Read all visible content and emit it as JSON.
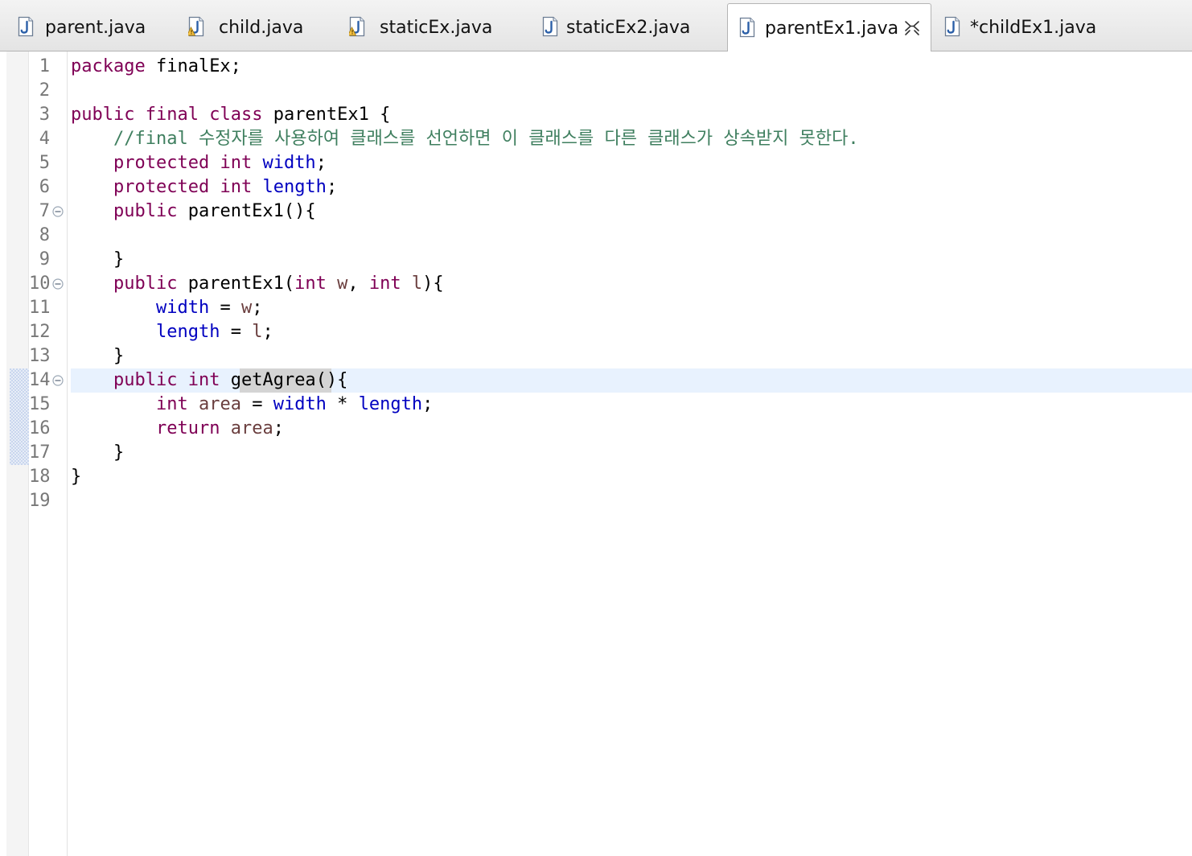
{
  "tabs": [
    {
      "label": "parent.java",
      "icon": "java-file-icon",
      "warning": false,
      "active": false
    },
    {
      "label": "child.java",
      "icon": "java-file-warning-icon",
      "warning": true,
      "active": false
    },
    {
      "label": "staticEx.java",
      "icon": "java-file-warning-icon",
      "warning": true,
      "active": false
    },
    {
      "label": "staticEx2.java",
      "icon": "java-file-icon",
      "warning": false,
      "active": false
    },
    {
      "label": "parentEx1.java",
      "icon": "java-file-icon",
      "warning": false,
      "active": true
    },
    {
      "label": "*childEx1.java",
      "icon": "java-file-icon",
      "warning": false,
      "active": false
    }
  ],
  "editor": {
    "colors": {
      "keyword": "#7f0055",
      "field": "#0000c0",
      "comment": "#3f7f5f",
      "local": "#6a3e3e",
      "current_line": "#e8f2fe",
      "occurrence": "#d4d4d4"
    },
    "current_line": 14,
    "lines": [
      {
        "n": "1",
        "fold": false,
        "tokens": [
          {
            "t": "package",
            "c": "kw"
          },
          {
            "t": " finalEx;",
            "c": "plain"
          }
        ]
      },
      {
        "n": "2",
        "fold": false,
        "tokens": []
      },
      {
        "n": "3",
        "fold": false,
        "tokens": [
          {
            "t": "public",
            "c": "kw"
          },
          {
            "t": " ",
            "c": "plain"
          },
          {
            "t": "final",
            "c": "kw"
          },
          {
            "t": " ",
            "c": "plain"
          },
          {
            "t": "class",
            "c": "kw"
          },
          {
            "t": " parentEx1 {",
            "c": "plain"
          }
        ]
      },
      {
        "n": "4",
        "fold": false,
        "tokens": [
          {
            "t": "    ",
            "c": "plain"
          },
          {
            "t": "//final 수정자를 사용하여 클래스를 선언하면 이 클래스를 다른 클래스가 상속받지 못한다.",
            "c": "cmt"
          }
        ]
      },
      {
        "n": "5",
        "fold": false,
        "tokens": [
          {
            "t": "    ",
            "c": "plain"
          },
          {
            "t": "protected",
            "c": "kw"
          },
          {
            "t": " ",
            "c": "plain"
          },
          {
            "t": "int",
            "c": "kw"
          },
          {
            "t": " ",
            "c": "plain"
          },
          {
            "t": "width",
            "c": "fld"
          },
          {
            "t": ";",
            "c": "plain"
          }
        ]
      },
      {
        "n": "6",
        "fold": false,
        "tokens": [
          {
            "t": "    ",
            "c": "plain"
          },
          {
            "t": "protected",
            "c": "kw"
          },
          {
            "t": " ",
            "c": "plain"
          },
          {
            "t": "int",
            "c": "kw"
          },
          {
            "t": " ",
            "c": "plain"
          },
          {
            "t": "length",
            "c": "fld"
          },
          {
            "t": ";",
            "c": "plain"
          }
        ]
      },
      {
        "n": "7",
        "fold": true,
        "tokens": [
          {
            "t": "    ",
            "c": "plain"
          },
          {
            "t": "public",
            "c": "kw"
          },
          {
            "t": " parentEx1(){",
            "c": "plain"
          }
        ]
      },
      {
        "n": "8",
        "fold": false,
        "tokens": []
      },
      {
        "n": "9",
        "fold": false,
        "tokens": [
          {
            "t": "    }",
            "c": "plain"
          }
        ]
      },
      {
        "n": "10",
        "fold": true,
        "tokens": [
          {
            "t": "    ",
            "c": "plain"
          },
          {
            "t": "public",
            "c": "kw"
          },
          {
            "t": " parentEx1(",
            "c": "plain"
          },
          {
            "t": "int",
            "c": "kw"
          },
          {
            "t": " ",
            "c": "plain"
          },
          {
            "t": "w",
            "c": "local"
          },
          {
            "t": ", ",
            "c": "plain"
          },
          {
            "t": "int",
            "c": "kw"
          },
          {
            "t": " ",
            "c": "plain"
          },
          {
            "t": "l",
            "c": "local"
          },
          {
            "t": "){",
            "c": "plain"
          }
        ]
      },
      {
        "n": "11",
        "fold": false,
        "tokens": [
          {
            "t": "        ",
            "c": "plain"
          },
          {
            "t": "width",
            "c": "fld"
          },
          {
            "t": " = ",
            "c": "plain"
          },
          {
            "t": "w",
            "c": "local"
          },
          {
            "t": ";",
            "c": "plain"
          }
        ]
      },
      {
        "n": "12",
        "fold": false,
        "tokens": [
          {
            "t": "        ",
            "c": "plain"
          },
          {
            "t": "length",
            "c": "fld"
          },
          {
            "t": " = ",
            "c": "plain"
          },
          {
            "t": "l",
            "c": "local"
          },
          {
            "t": ";",
            "c": "plain"
          }
        ]
      },
      {
        "n": "13",
        "fold": false,
        "tokens": [
          {
            "t": "    }",
            "c": "plain"
          }
        ]
      },
      {
        "n": "14",
        "fold": true,
        "tokens": [
          {
            "t": "    ",
            "c": "plain"
          },
          {
            "t": "public",
            "c": "kw"
          },
          {
            "t": " ",
            "c": "plain"
          },
          {
            "t": "int",
            "c": "kw"
          },
          {
            "t": " ",
            "c": "plain"
          },
          {
            "t": "getAgrea",
            "c": "plain",
            "occ": true
          },
          {
            "t": "(){",
            "c": "plain"
          }
        ]
      },
      {
        "n": "15",
        "fold": false,
        "tokens": [
          {
            "t": "        ",
            "c": "plain"
          },
          {
            "t": "int",
            "c": "kw"
          },
          {
            "t": " ",
            "c": "plain"
          },
          {
            "t": "area",
            "c": "local"
          },
          {
            "t": " = ",
            "c": "plain"
          },
          {
            "t": "width",
            "c": "fld"
          },
          {
            "t": " * ",
            "c": "plain"
          },
          {
            "t": "length",
            "c": "fld"
          },
          {
            "t": ";",
            "c": "plain"
          }
        ]
      },
      {
        "n": "16",
        "fold": false,
        "tokens": [
          {
            "t": "        ",
            "c": "plain"
          },
          {
            "t": "return",
            "c": "kw"
          },
          {
            "t": " ",
            "c": "plain"
          },
          {
            "t": "area",
            "c": "local"
          },
          {
            "t": ";",
            "c": "plain"
          }
        ]
      },
      {
        "n": "17",
        "fold": false,
        "tokens": [
          {
            "t": "    }",
            "c": "plain"
          }
        ]
      },
      {
        "n": "18",
        "fold": false,
        "tokens": [
          {
            "t": "}",
            "c": "plain"
          }
        ]
      },
      {
        "n": "19",
        "fold": false,
        "tokens": []
      }
    ]
  }
}
